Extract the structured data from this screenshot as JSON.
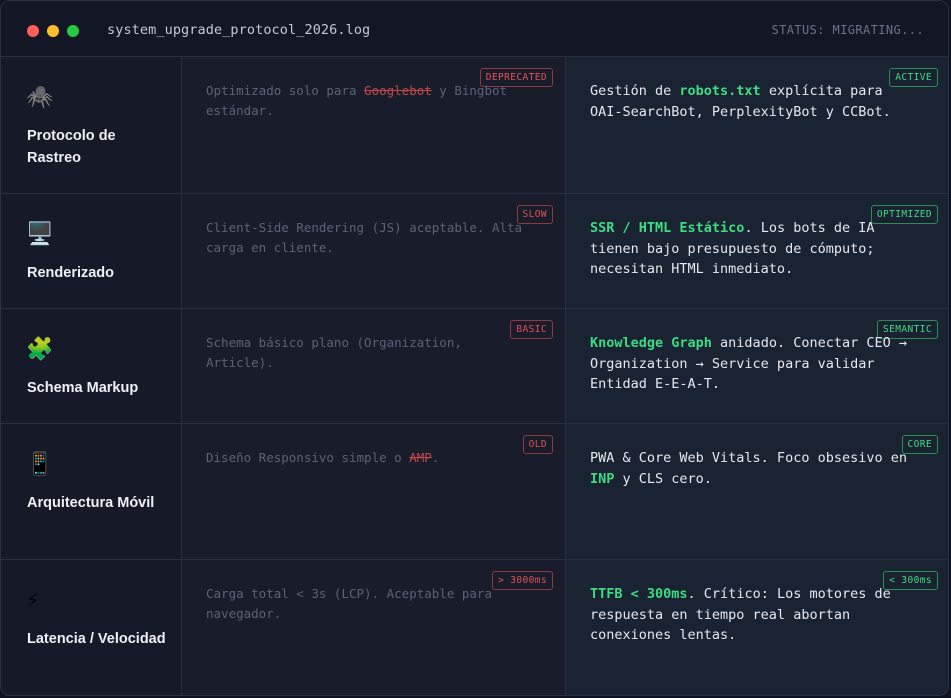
{
  "window": {
    "title": "system_upgrade_protocol_2026.log",
    "status": "STATUS: MIGRATING..."
  },
  "rows": [
    {
      "icon": "spider-icon",
      "icon_glyph": "🕷️",
      "category": "Protocolo de Rastreo",
      "old": {
        "badge": "DEPRECATED",
        "text_before": "Optimizado solo para ",
        "strike": "Googlebot",
        "text_after": " y Bingbot estándar."
      },
      "new": {
        "badge": "ACTIVE",
        "text_before": "Gestión de ",
        "highlight": "robots.txt",
        "text_after": " explícita para OAI-SearchBot, PerplexityBot y CCBot."
      }
    },
    {
      "icon": "desktop-computer-icon",
      "icon_glyph": "🖥️",
      "category": "Renderizado",
      "old": {
        "badge": "SLOW",
        "text_before": "Client-Side Rendering (JS) aceptable. Alta carga en cliente.",
        "strike": "",
        "text_after": ""
      },
      "new": {
        "badge": "OPTIMIZED",
        "text_before": "",
        "highlight": "SSR / HTML Estático",
        "text_after": ". Los bots de IA tienen bajo presupuesto de cómputo; necesitan HTML inmediato."
      }
    },
    {
      "icon": "puzzle-piece-icon",
      "icon_glyph": "🧩",
      "category": "Schema Markup",
      "old": {
        "badge": "BASIC",
        "text_before": "Schema básico plano (Organization, Article).",
        "strike": "",
        "text_after": ""
      },
      "new": {
        "badge": "SEMANTIC",
        "text_before": "",
        "highlight": "Knowledge Graph",
        "text_after": " anidado. Conectar CEO → Organization → Service para validar Entidad E-E-A-T."
      }
    },
    {
      "icon": "mobile-phone-icon",
      "icon_glyph": "📱",
      "category": "Arquitectura Móvil",
      "old": {
        "badge": "OLD",
        "text_before": "Diseño Responsivo simple o ",
        "strike": "AMP",
        "text_after": "."
      },
      "new": {
        "badge": "CORE",
        "text_before": "PWA & Core Web Vitals. Foco obsesivo en ",
        "highlight": "INP",
        "text_after": " y CLS cero."
      }
    },
    {
      "icon": "lightning-icon",
      "icon_glyph": "⚡",
      "category": "Latencia / Velocidad",
      "old": {
        "badge": "> 3000ms",
        "text_before": "Carga total < 3s (LCP). Aceptable para navegador.",
        "strike": "",
        "text_after": ""
      },
      "new": {
        "badge": "< 300ms",
        "text_before": "",
        "highlight": "TTFB < 300ms",
        "text_after": ". Crítico: Los motores de respuesta en tiempo real abortan conexiones lentas."
      }
    }
  ],
  "colors": {
    "accent_green": "#3ddc84",
    "deprecated_red": "#e0525a",
    "background": "#191c2b",
    "new_column_bg": "#1a2332"
  }
}
